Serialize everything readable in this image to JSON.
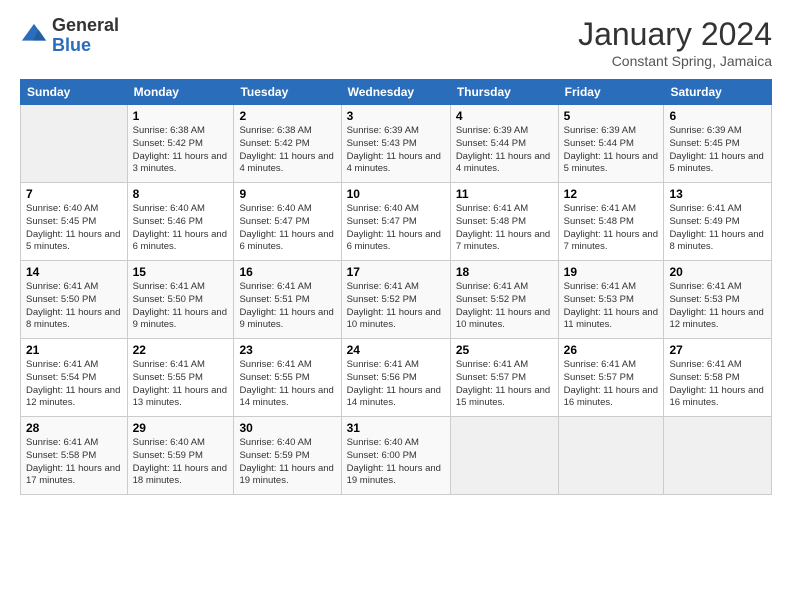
{
  "header": {
    "logo_general": "General",
    "logo_blue": "Blue",
    "month_title": "January 2024",
    "subtitle": "Constant Spring, Jamaica"
  },
  "days_of_week": [
    "Sunday",
    "Monday",
    "Tuesday",
    "Wednesday",
    "Thursday",
    "Friday",
    "Saturday"
  ],
  "weeks": [
    [
      {
        "day": "",
        "sunrise": "",
        "sunset": "",
        "daylight": "",
        "empty": true
      },
      {
        "day": "1",
        "sunrise": "Sunrise: 6:38 AM",
        "sunset": "Sunset: 5:42 PM",
        "daylight": "Daylight: 11 hours and 3 minutes."
      },
      {
        "day": "2",
        "sunrise": "Sunrise: 6:38 AM",
        "sunset": "Sunset: 5:42 PM",
        "daylight": "Daylight: 11 hours and 4 minutes."
      },
      {
        "day": "3",
        "sunrise": "Sunrise: 6:39 AM",
        "sunset": "Sunset: 5:43 PM",
        "daylight": "Daylight: 11 hours and 4 minutes."
      },
      {
        "day": "4",
        "sunrise": "Sunrise: 6:39 AM",
        "sunset": "Sunset: 5:44 PM",
        "daylight": "Daylight: 11 hours and 4 minutes."
      },
      {
        "day": "5",
        "sunrise": "Sunrise: 6:39 AM",
        "sunset": "Sunset: 5:44 PM",
        "daylight": "Daylight: 11 hours and 5 minutes."
      },
      {
        "day": "6",
        "sunrise": "Sunrise: 6:39 AM",
        "sunset": "Sunset: 5:45 PM",
        "daylight": "Daylight: 11 hours and 5 minutes."
      }
    ],
    [
      {
        "day": "7",
        "sunrise": "Sunrise: 6:40 AM",
        "sunset": "Sunset: 5:45 PM",
        "daylight": "Daylight: 11 hours and 5 minutes."
      },
      {
        "day": "8",
        "sunrise": "Sunrise: 6:40 AM",
        "sunset": "Sunset: 5:46 PM",
        "daylight": "Daylight: 11 hours and 6 minutes."
      },
      {
        "day": "9",
        "sunrise": "Sunrise: 6:40 AM",
        "sunset": "Sunset: 5:47 PM",
        "daylight": "Daylight: 11 hours and 6 minutes."
      },
      {
        "day": "10",
        "sunrise": "Sunrise: 6:40 AM",
        "sunset": "Sunset: 5:47 PM",
        "daylight": "Daylight: 11 hours and 6 minutes."
      },
      {
        "day": "11",
        "sunrise": "Sunrise: 6:41 AM",
        "sunset": "Sunset: 5:48 PM",
        "daylight": "Daylight: 11 hours and 7 minutes."
      },
      {
        "day": "12",
        "sunrise": "Sunrise: 6:41 AM",
        "sunset": "Sunset: 5:48 PM",
        "daylight": "Daylight: 11 hours and 7 minutes."
      },
      {
        "day": "13",
        "sunrise": "Sunrise: 6:41 AM",
        "sunset": "Sunset: 5:49 PM",
        "daylight": "Daylight: 11 hours and 8 minutes."
      }
    ],
    [
      {
        "day": "14",
        "sunrise": "Sunrise: 6:41 AM",
        "sunset": "Sunset: 5:50 PM",
        "daylight": "Daylight: 11 hours and 8 minutes."
      },
      {
        "day": "15",
        "sunrise": "Sunrise: 6:41 AM",
        "sunset": "Sunset: 5:50 PM",
        "daylight": "Daylight: 11 hours and 9 minutes."
      },
      {
        "day": "16",
        "sunrise": "Sunrise: 6:41 AM",
        "sunset": "Sunset: 5:51 PM",
        "daylight": "Daylight: 11 hours and 9 minutes."
      },
      {
        "day": "17",
        "sunrise": "Sunrise: 6:41 AM",
        "sunset": "Sunset: 5:52 PM",
        "daylight": "Daylight: 11 hours and 10 minutes."
      },
      {
        "day": "18",
        "sunrise": "Sunrise: 6:41 AM",
        "sunset": "Sunset: 5:52 PM",
        "daylight": "Daylight: 11 hours and 10 minutes."
      },
      {
        "day": "19",
        "sunrise": "Sunrise: 6:41 AM",
        "sunset": "Sunset: 5:53 PM",
        "daylight": "Daylight: 11 hours and 11 minutes."
      },
      {
        "day": "20",
        "sunrise": "Sunrise: 6:41 AM",
        "sunset": "Sunset: 5:53 PM",
        "daylight": "Daylight: 11 hours and 12 minutes."
      }
    ],
    [
      {
        "day": "21",
        "sunrise": "Sunrise: 6:41 AM",
        "sunset": "Sunset: 5:54 PM",
        "daylight": "Daylight: 11 hours and 12 minutes."
      },
      {
        "day": "22",
        "sunrise": "Sunrise: 6:41 AM",
        "sunset": "Sunset: 5:55 PM",
        "daylight": "Daylight: 11 hours and 13 minutes."
      },
      {
        "day": "23",
        "sunrise": "Sunrise: 6:41 AM",
        "sunset": "Sunset: 5:55 PM",
        "daylight": "Daylight: 11 hours and 14 minutes."
      },
      {
        "day": "24",
        "sunrise": "Sunrise: 6:41 AM",
        "sunset": "Sunset: 5:56 PM",
        "daylight": "Daylight: 11 hours and 14 minutes."
      },
      {
        "day": "25",
        "sunrise": "Sunrise: 6:41 AM",
        "sunset": "Sunset: 5:57 PM",
        "daylight": "Daylight: 11 hours and 15 minutes."
      },
      {
        "day": "26",
        "sunrise": "Sunrise: 6:41 AM",
        "sunset": "Sunset: 5:57 PM",
        "daylight": "Daylight: 11 hours and 16 minutes."
      },
      {
        "day": "27",
        "sunrise": "Sunrise: 6:41 AM",
        "sunset": "Sunset: 5:58 PM",
        "daylight": "Daylight: 11 hours and 16 minutes."
      }
    ],
    [
      {
        "day": "28",
        "sunrise": "Sunrise: 6:41 AM",
        "sunset": "Sunset: 5:58 PM",
        "daylight": "Daylight: 11 hours and 17 minutes."
      },
      {
        "day": "29",
        "sunrise": "Sunrise: 6:40 AM",
        "sunset": "Sunset: 5:59 PM",
        "daylight": "Daylight: 11 hours and 18 minutes."
      },
      {
        "day": "30",
        "sunrise": "Sunrise: 6:40 AM",
        "sunset": "Sunset: 5:59 PM",
        "daylight": "Daylight: 11 hours and 19 minutes."
      },
      {
        "day": "31",
        "sunrise": "Sunrise: 6:40 AM",
        "sunset": "Sunset: 6:00 PM",
        "daylight": "Daylight: 11 hours and 19 minutes."
      },
      {
        "day": "",
        "sunrise": "",
        "sunset": "",
        "daylight": "",
        "empty": true
      },
      {
        "day": "",
        "sunrise": "",
        "sunset": "",
        "daylight": "",
        "empty": true
      },
      {
        "day": "",
        "sunrise": "",
        "sunset": "",
        "daylight": "",
        "empty": true
      }
    ]
  ]
}
